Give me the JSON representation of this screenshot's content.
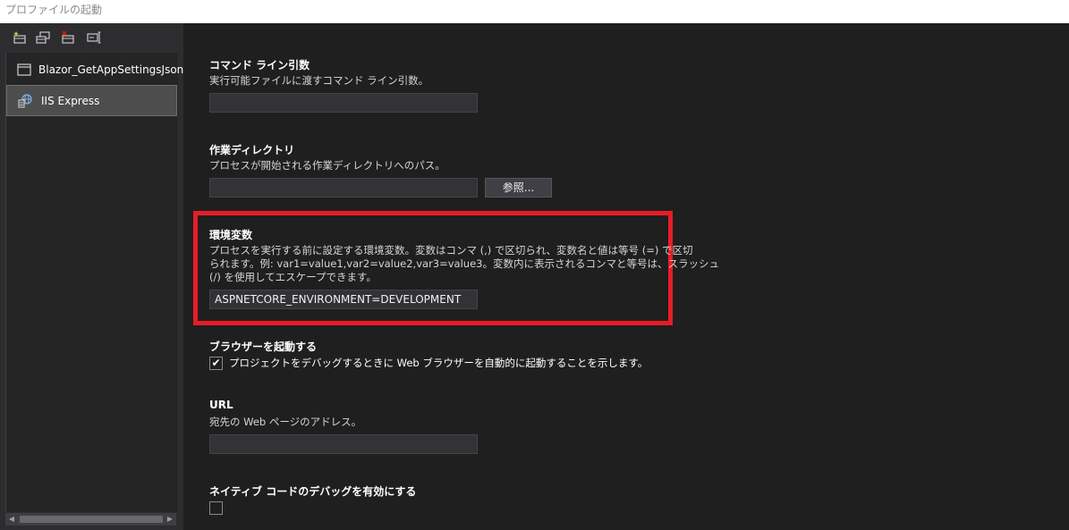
{
  "window": {
    "title": "プロファイルの起動"
  },
  "sidebar": {
    "toolbar_icons": [
      "new-profile-icon",
      "copy-profile-icon",
      "delete-profile-icon",
      "rename-profile-icon"
    ],
    "profiles": [
      {
        "label": "Blazor_GetAppSettingsJson",
        "icon": "window-icon",
        "selected": false
      },
      {
        "label": "IIS Express",
        "icon": "iis-server-icon",
        "selected": true
      }
    ]
  },
  "sections": {
    "command_line": {
      "label": "コマンド ライン引数",
      "description": "実行可能ファイルに渡すコマンド ライン引数。",
      "value": ""
    },
    "working_dir": {
      "label": "作業ディレクトリ",
      "description": "プロセスが開始される作業ディレクトリへのパス。",
      "value": "",
      "browse_label": "参照..."
    },
    "env_vars": {
      "label": "環境変数",
      "description_lines": [
        "プロセスを実行する前に設定する環境変数。変数はコンマ (,) で区切られ、変数名と値は等号 (=) で区切",
        "られます。例: var1=value1,var2=value2,var3=value3。変数内に表示されるコンマと等号は、スラッシュ",
        "(/) を使用してエスケープできます。"
      ],
      "value": "ASPNETCORE_ENVIRONMENT=DEVELOPMENT",
      "highlight_color": "#e81c27"
    },
    "launch_browser": {
      "label": "ブラウザーを起動する",
      "checkbox_label": "プロジェクトをデバッグするときに Web ブラウザーを自動的に起動することを示します。",
      "checked": true
    },
    "url": {
      "label": "URL",
      "description": "宛先の Web ページのアドレス。",
      "value": ""
    },
    "native_debug": {
      "label": "ネイティブ コードのデバッグを有効にする",
      "checked": false
    }
  }
}
